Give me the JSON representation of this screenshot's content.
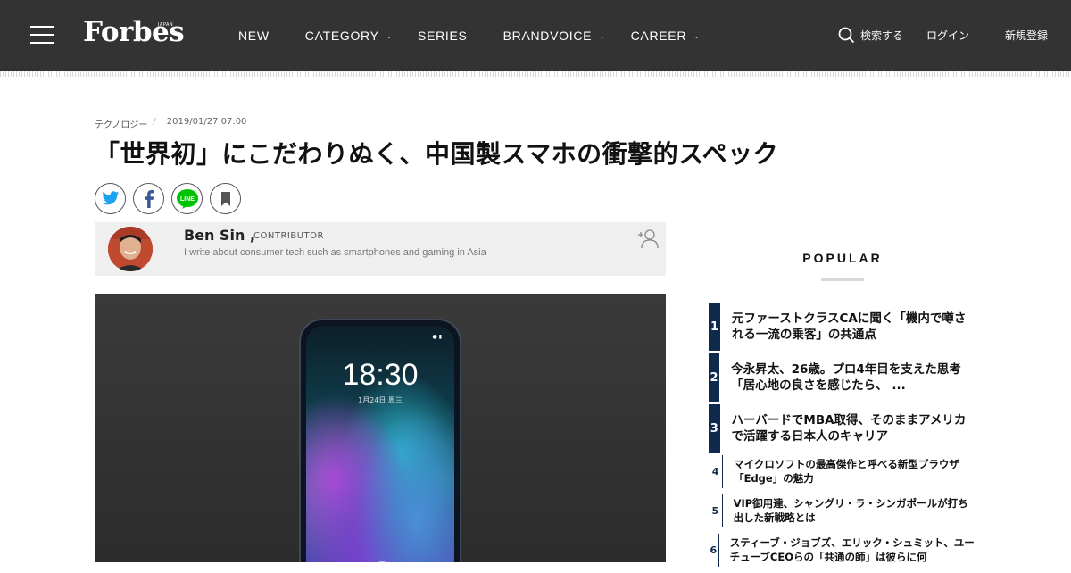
{
  "header": {
    "logo": "Forbes",
    "logo_sub": "JAPAN",
    "nav": [
      {
        "label": "NEW"
      },
      {
        "label": "CATEGORY"
      },
      {
        "label": "SERIES"
      },
      {
        "label": "BRANDVOICE"
      },
      {
        "label": "CAREER"
      }
    ],
    "search_label": "検索する",
    "login_label": "ログイン",
    "signup_label": "新規登録"
  },
  "article": {
    "category": "テクノロジー",
    "separator": "/",
    "date": "2019/01/27 07:00",
    "title": "「世界初」にこだわりぬく、中国製スマホの衝撃的スペック"
  },
  "share_buttons": [
    {
      "icon": "twitter-icon",
      "color": "#1da1f2"
    },
    {
      "icon": "facebook-icon",
      "color": "#3b5998"
    },
    {
      "icon": "line-icon",
      "color": "#00c300"
    },
    {
      "icon": "bookmark-icon",
      "color": "#555555"
    }
  ],
  "author": {
    "name": "Ben Sin ,",
    "role": "CONTRIBUTOR",
    "description": "I write about consumer tech such as smartphones and gaming in Asia"
  },
  "hero": {
    "clock": "18:30",
    "clock_date": "1月24日 周三"
  },
  "popular": {
    "title": "POPULAR",
    "items": [
      {
        "rank": "1",
        "text": "元ファーストクラスCAに聞く「機内で噂される一流の乗客」の共通点"
      },
      {
        "rank": "2",
        "text": "今永昇太、26歳。プロ4年目を支えた思考「居心地の良さを感じたら、 ..."
      },
      {
        "rank": "3",
        "text": "ハーバードでMBA取得、そのままアメリカで活躍する日本人のキャリア"
      },
      {
        "rank": "4",
        "text": "マイクロソフトの最高傑作と呼べる新型ブラウザ「Edge」の魅力"
      },
      {
        "rank": "5",
        "text": "VIP御用達、シャングリ・ラ・シンガポールが打ち出した新戦略とは"
      },
      {
        "rank": "6",
        "text": "スティーブ・ジョブズ、エリック・シュミット、ユーチューブCEOらの「共通の師」は彼らに何"
      }
    ]
  },
  "colors": {
    "header_bg": "#333333",
    "accent_navy": "#0f2a4d"
  }
}
